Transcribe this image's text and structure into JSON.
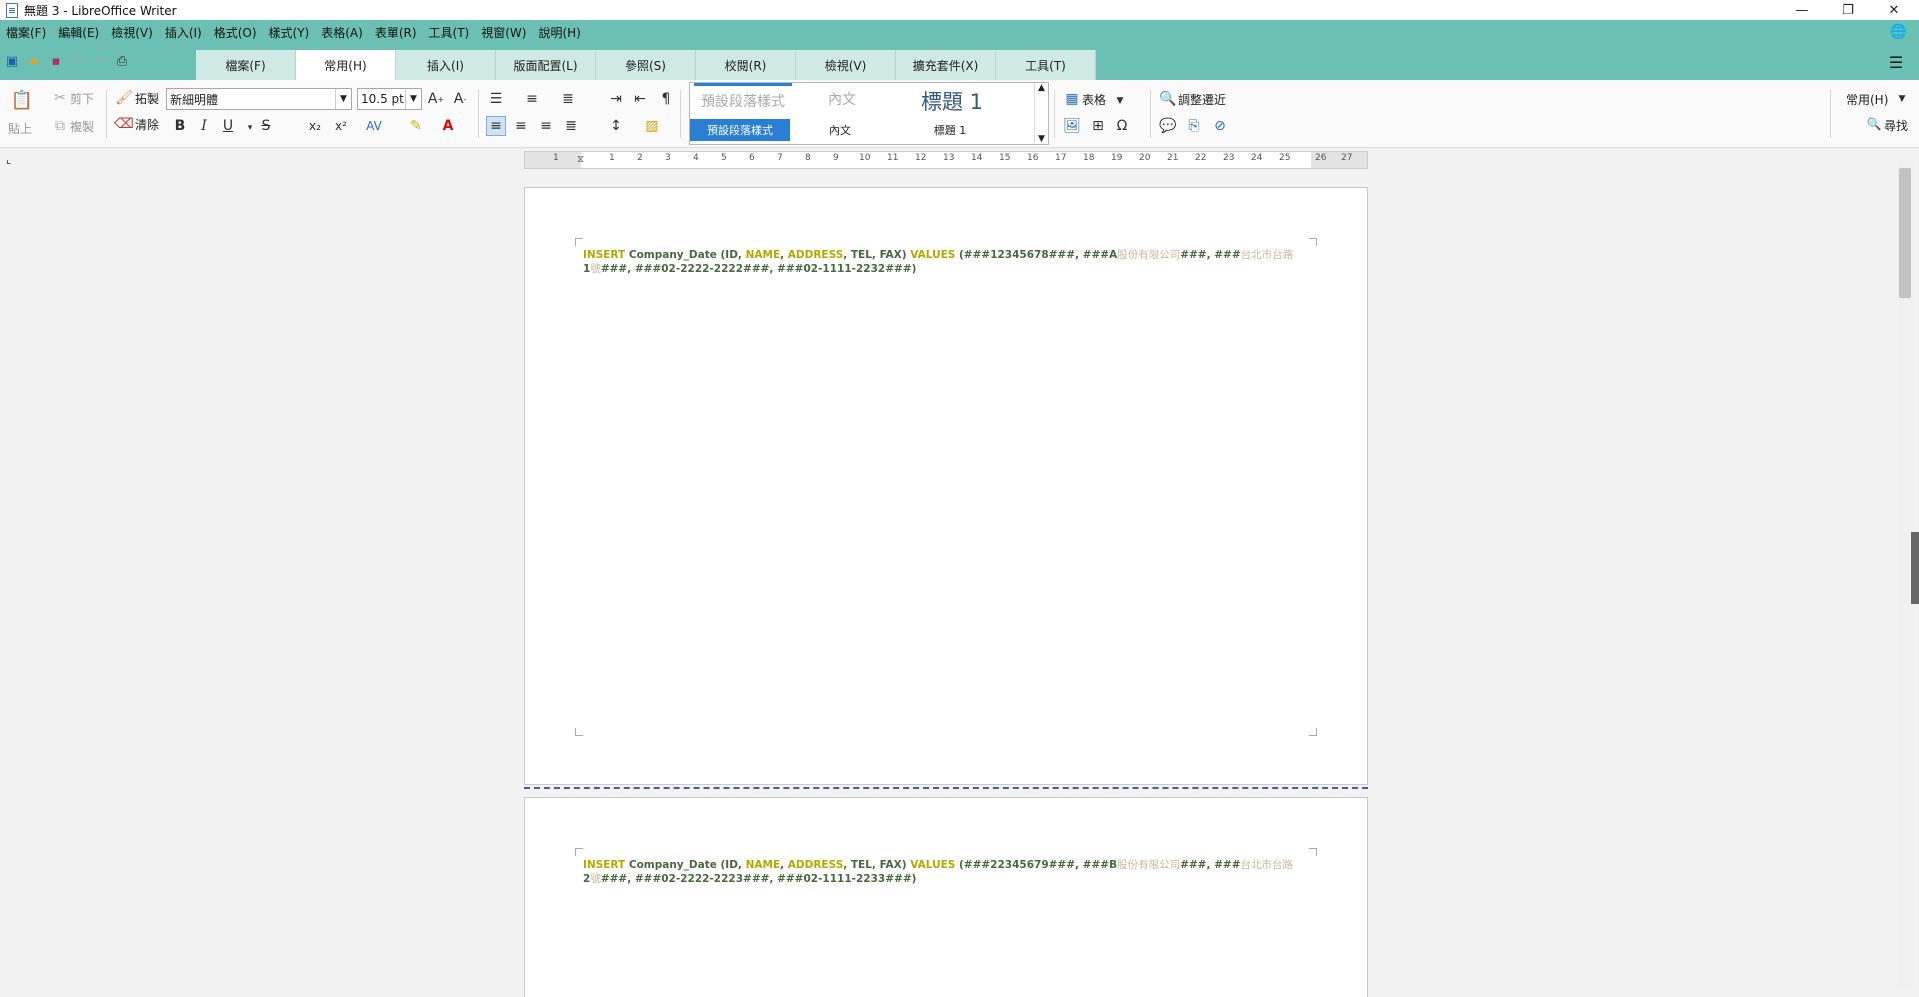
{
  "window": {
    "title": "無題 3 - LibreOffice Writer",
    "controls": [
      "—",
      "❐",
      "✕"
    ]
  },
  "menubar": {
    "items": [
      "檔案(F)",
      "編輯(E)",
      "檢視(V)",
      "插入(I)",
      "格式(O)",
      "樣式(Y)",
      "表格(A)",
      "表單(R)",
      "工具(T)",
      "視窗(W)",
      "說明(H)"
    ]
  },
  "tabs": {
    "items": [
      "檔案(F)",
      "常用(H)",
      "插入(I)",
      "版面配置(L)",
      "參照(S)",
      "校閱(R)",
      "檢視(V)",
      "擴充套件(X)",
      "工具(T)"
    ],
    "active": "常用(H)"
  },
  "ribbon": {
    "paste": "貼上",
    "cut": "剪下",
    "copy": "複製",
    "clone": "拓製",
    "clear": "清除",
    "font_name": "新細明體",
    "font_size": "10.5 pt",
    "styles": {
      "default_para_preview": "預設段落樣式",
      "body_preview": "內文",
      "heading1_preview": "標題 1",
      "default_para_label": "預設段落樣式",
      "body_label": "內文",
      "heading1_label": "標題 1"
    },
    "table": "表格",
    "find_replace": "調整遷近",
    "notebookbar_mode": "常用(H)",
    "find": "尋找"
  },
  "ruler": {
    "ticks": [
      "1",
      "1",
      "2",
      "3",
      "4",
      "5",
      "6",
      "7",
      "8",
      "9",
      "10",
      "11",
      "12",
      "13",
      "14",
      "15",
      "16",
      "17",
      "18",
      "19",
      "20",
      "21",
      "22",
      "23",
      "24",
      "25",
      "26",
      "27"
    ]
  },
  "document": {
    "page1": {
      "line1": {
        "insert": "INSERT",
        "table": " Company_Date (ID, ",
        "name": "NAME",
        "comma1": ", ",
        "address": "ADDRESS",
        "rest": ", TEL, FAX) ",
        "values": "VALUES",
        "v": " (###12345678###, ###A",
        "cjk1": "股份有限公司",
        "v2": "###, ###",
        "cjk2": "台北市台路"
      },
      "line2": {
        "num": "1",
        "cjk": "號",
        "rest": "###, ###02-2222-2222###, ###02-1111-2232###)"
      }
    },
    "page2": {
      "line1": {
        "insert": "INSERT",
        "table": " Company_Date (ID, ",
        "name": "NAME",
        "comma1": ", ",
        "address": "ADDRESS",
        "rest": ", TEL, FAX) ",
        "values": "VALUES",
        "v": " (###22345679###, ###B",
        "cjk1": "股份有限公司",
        "v2": "###, ###",
        "cjk2": "台北市台路"
      },
      "line2": {
        "num": "2",
        "cjk": "號",
        "rest": "###, ###02-2222-2223###, ###02-1111-2233###)"
      }
    }
  },
  "colors": {
    "accent": "#6cc0b3",
    "keyword": "#b4a800",
    "text_dark_green": "#4a6840",
    "style_selected": "#2a7fd4"
  }
}
